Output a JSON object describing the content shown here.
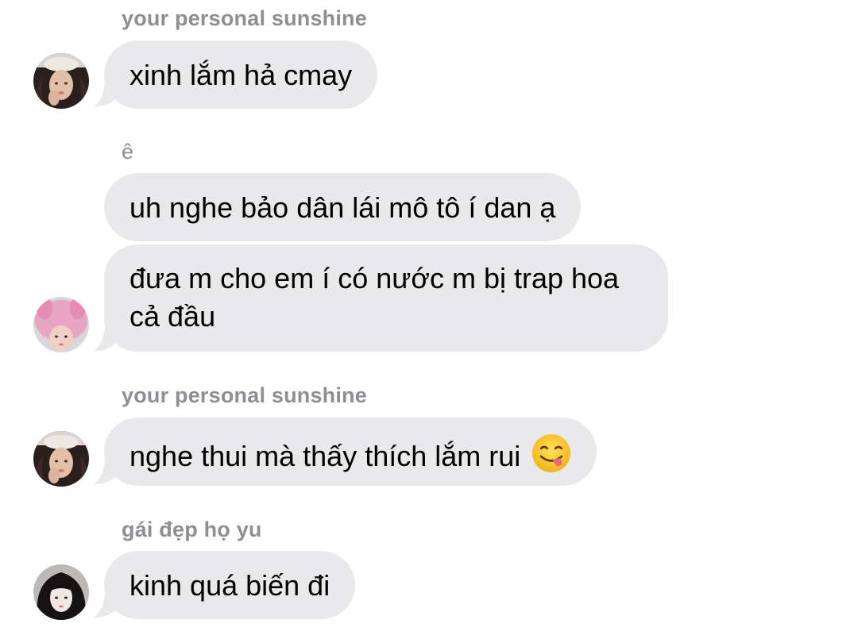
{
  "messages": [
    {
      "sender": "your personal sunshine",
      "text": "xinh lắm hả cmay",
      "avatar": "avatar-sunshine"
    },
    {
      "sender": "ê",
      "text": "uh nghe bảo dân lái mô tô í dan ạ",
      "avatar": null
    },
    {
      "sender": null,
      "text": "đưa m cho em í có nước m bị trap hoa cả đầu",
      "avatar": "avatar-pink-bunny-hat"
    },
    {
      "sender": "your personal sunshine",
      "text": "nghe thui mà thấy thích lắm rui",
      "emoji": "face-savoring-food-emoji",
      "avatar": "avatar-sunshine"
    },
    {
      "sender": "gái đẹp họ yu",
      "text": "kinh quá biến đi",
      "avatar": "avatar-yu"
    }
  ],
  "colors": {
    "bubble": "#e9e9eb",
    "sender_label": "#8e8e93",
    "text": "#000000",
    "background": "#ffffff"
  }
}
